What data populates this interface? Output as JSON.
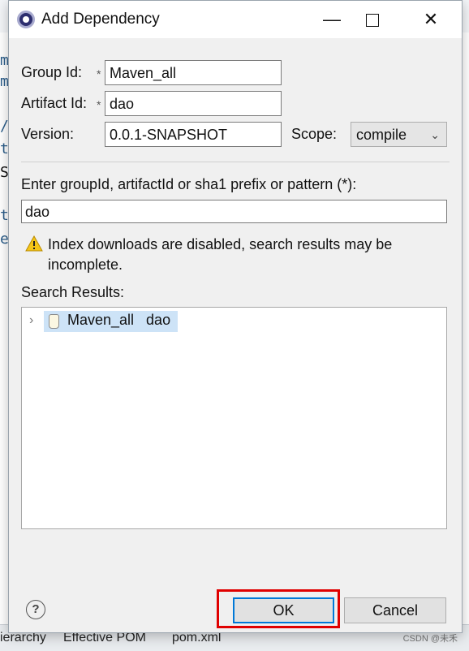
{
  "window": {
    "title": "Add Dependency"
  },
  "form": {
    "group_id_label": "Group Id:",
    "group_id_value": "Maven_all",
    "artifact_id_label": "Artifact Id:",
    "artifact_id_value": "dao",
    "version_label": "Version:",
    "version_value": "0.0.1-SNAPSHOT",
    "scope_label": "Scope:",
    "scope_value": "compile",
    "required_marker": "*"
  },
  "search": {
    "prompt_label": "Enter groupId, artifactId or sha1 prefix or pattern (*):",
    "query_value": "dao",
    "warning_text": "Index downloads are disabled, search results may be incomplete.",
    "results_label": "Search Results:",
    "results": [
      {
        "label": "Maven_all   dao",
        "expanded": false,
        "selected": true
      }
    ]
  },
  "buttons": {
    "help": "?",
    "ok": "OK",
    "cancel": "Cancel"
  },
  "background": {
    "bottom_tabs": [
      "ierarchy",
      "Effective POM",
      "pom.xml"
    ],
    "watermark": "CSDN @未禾",
    "code_glyphs": [
      "m",
      "m",
      "/",
      "t",
      "S",
      "t",
      "e"
    ]
  },
  "icons": {
    "title": "eclipse-icon",
    "warning": "warning-icon",
    "jar": "jar-icon",
    "help": "help-icon",
    "expand": "chevron-right-icon",
    "scope": "chevron-down-icon"
  },
  "colors": {
    "highlight": "#e00000",
    "selection": "#cde3f7",
    "default_button_border": "#0078d7"
  }
}
